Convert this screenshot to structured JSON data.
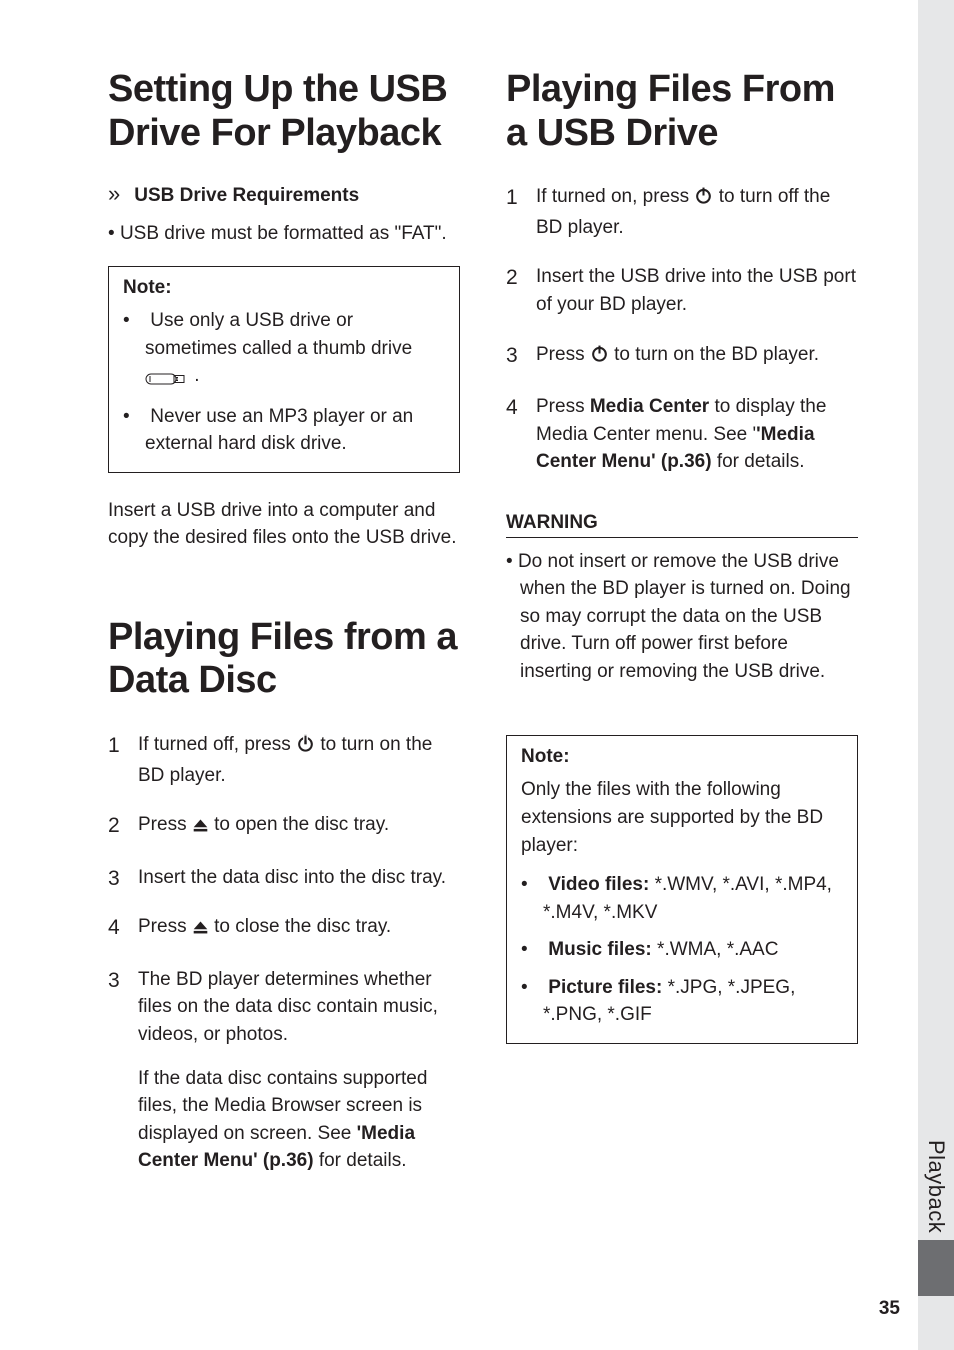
{
  "left": {
    "h1_a": "Setting Up the USB Drive For Playback",
    "sub_bullet": "»",
    "sub_title": "USB Drive Requirements",
    "req1": "USB drive must be formatted as \"FAT\".",
    "note_title": "Note:",
    "note_items": [
      "Use only a USB drive or sometimes called a thumb drive ",
      "Never use an MP3 player or an external hard disk drive."
    ],
    "note_tail0": " .",
    "insert_para": "Insert a USB drive into a computer and copy the desired files onto the USB drive.",
    "h1_b": "Playing Files from a Data Disc",
    "steps_b": [
      {
        "pre": "If turned off, press ",
        "icon": "power",
        "post": " to turn on the BD player."
      },
      {
        "pre": "Press ",
        "icon": "eject",
        "post": " to open the disc tray."
      },
      {
        "pre": "Insert the data disc into the disc tray.",
        "icon": "",
        "post": ""
      },
      {
        "pre": "Press ",
        "icon": "eject",
        "post": " to close the disc tray."
      },
      {
        "num_override": "3",
        "pre": "The BD player determines whether files on the data disc contain music, videos, or photos.",
        "icon": "",
        "post": "",
        "extra_pre": "If the data disc contains supported files, the Media Browser screen is displayed on screen. See ",
        "extra_bold": "'Media Center Menu' (p.36)",
        "extra_post": " for details."
      }
    ]
  },
  "right": {
    "h1": "Playing Files From a USB Drive",
    "steps": [
      {
        "pre": "If turned on, press ",
        "icon": "power",
        "post": " to turn off the BD player."
      },
      {
        "pre": "Insert the USB drive into the USB port of your BD player.",
        "icon": "",
        "post": ""
      },
      {
        "pre": "Press ",
        "icon": "power",
        "post": " to turn on the BD player."
      },
      {
        "pre": "Press ",
        "bold1": "Media Center",
        "mid": " to display the Media Center menu. See '",
        "bold2": "'Media Center Menu' (p.36)",
        "post": " for details."
      }
    ],
    "warn_title": "WARNING",
    "warn_body": "Do not insert or remove the USB drive when the BD player is turned on. Doing so may corrupt the data on the USB drive. Turn off power first before inserting or removing the USB drive.",
    "note2_title": "Note:",
    "note2_intro": "Only the files with the following extensions are supported by the BD player:",
    "note2_items": [
      {
        "label": "Video files:",
        "val": " *.WMV, *.AVI, *.MP4, *.M4V, *.MKV"
      },
      {
        "label": "Music files:",
        "val": " *.WMA, *.AAC"
      },
      {
        "label": "Picture files:",
        "val": " *.JPG, *.JPEG, *.PNG, *.GIF"
      }
    ]
  },
  "side_label": "Playback",
  "page_num": "35"
}
